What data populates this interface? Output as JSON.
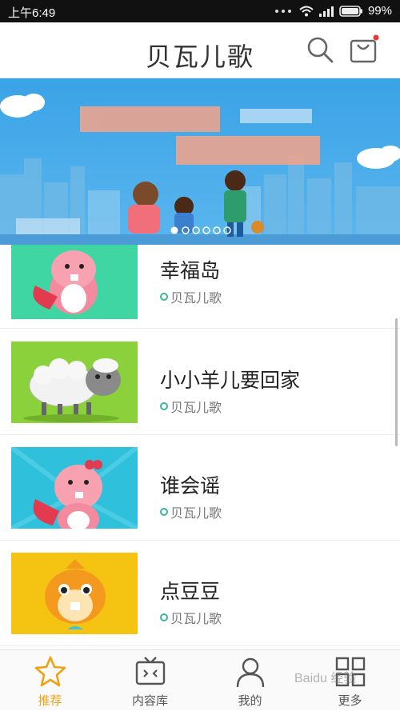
{
  "status_bar": {
    "time": "上午6:49",
    "battery": "99%"
  },
  "app_bar": {
    "title": "贝瓦儿歌",
    "search_icon": "search-icon",
    "cart_icon": "shopping-bag-icon"
  },
  "banner": {
    "page_count": 6,
    "active_page": 1
  },
  "list": [
    {
      "title": "幸福岛",
      "author": "贝瓦儿歌",
      "thumb_bg": "#3fd6a3",
      "character": "pink-beaver"
    },
    {
      "title": "小小羊儿要回家",
      "author": "贝瓦儿歌",
      "thumb_bg": "#8bd13b",
      "character": "sheep"
    },
    {
      "title": "谁会谣",
      "author": "贝瓦儿歌",
      "thumb_bg": "#2fc1dc",
      "character": "pink-beaver"
    },
    {
      "title": "点豆豆",
      "author": "贝瓦儿歌",
      "thumb_bg": "#f5c312",
      "character": "orange-beaver"
    }
  ],
  "tab_bar": {
    "tabs": [
      {
        "label": "推荐",
        "icon": "star-icon",
        "active": true
      },
      {
        "label": "内容库",
        "icon": "tv-icon",
        "active": false
      },
      {
        "label": "我的",
        "icon": "person-icon",
        "active": false
      },
      {
        "label": "更多",
        "icon": "grid-icon",
        "active": false
      }
    ]
  },
  "watermark": "Baidu 经验",
  "colors": {
    "accent": "#f0a214",
    "banner_sky": "#3aa3e6"
  }
}
